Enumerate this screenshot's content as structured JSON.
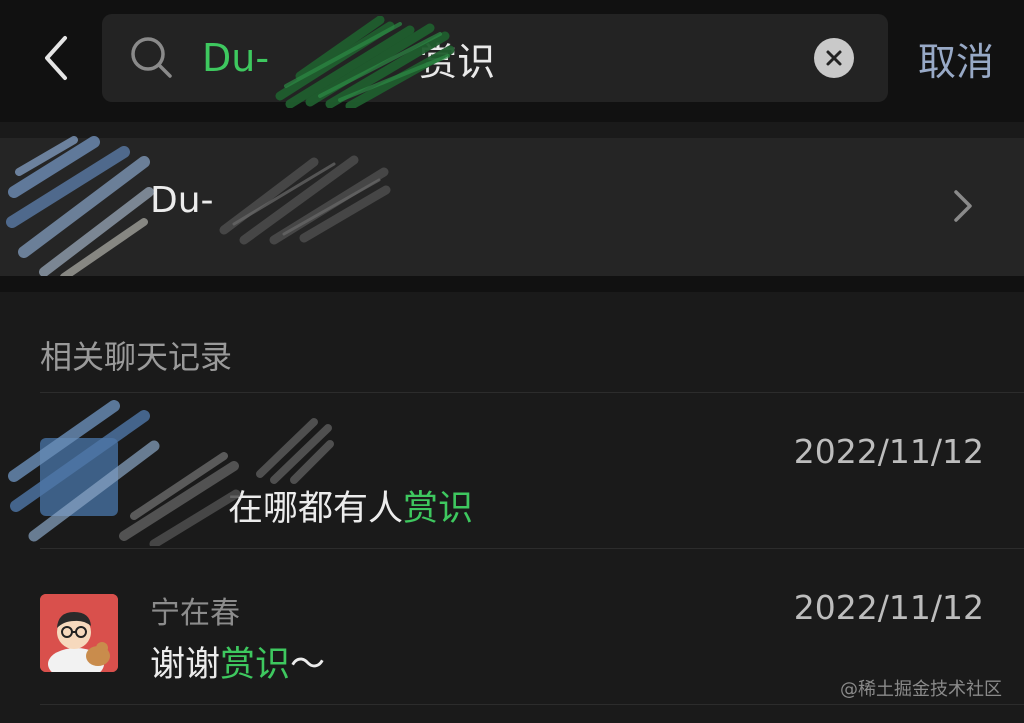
{
  "search": {
    "query_prefix": "Du-",
    "query_suffix": "赏识",
    "cancel_label": "取消"
  },
  "contact": {
    "name": "Du-"
  },
  "section": {
    "title": "相关聊天记录"
  },
  "chats": [
    {
      "sender": "",
      "date": "2022/11/12",
      "message_before": "在哪都有人",
      "message_highlight": "赏识",
      "message_after": ""
    },
    {
      "sender": "宁在春",
      "date": "2022/11/12",
      "message_before": "谢谢",
      "message_highlight": "赏识",
      "message_after": "～"
    }
  ],
  "watermark": "@稀土掘金技术社区",
  "colors": {
    "highlight": "#3ec85f",
    "cancel": "#98a9c6",
    "background": "#1a1a1a",
    "card": "#252525"
  }
}
